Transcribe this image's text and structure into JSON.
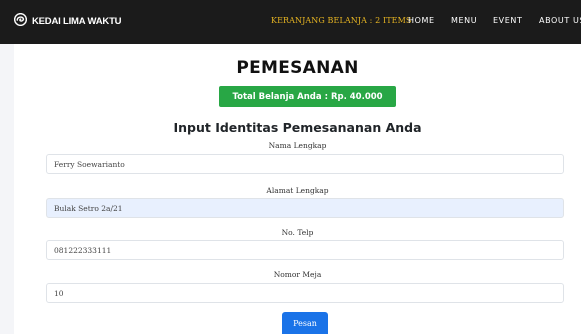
{
  "navbar": {
    "brand": "KEDAI LIMA WAKTU",
    "brand_icon": "swirl-logo-icon",
    "cart_label": "KERANJANG BELANJA : 2 ITEMS",
    "links": [
      "HOME",
      "MENU",
      "EVENT",
      "ABOUT US"
    ]
  },
  "page": {
    "title": "PEMESANAN",
    "total_label": "Total Belanja Anda : Rp. 40.000",
    "form_heading": "Input Identitas Pemesananan Anda"
  },
  "form": {
    "nama": {
      "label": "Nama Lengkap",
      "value": "Ferry Soewarianto"
    },
    "alamat": {
      "label": "Alamat Lengkap",
      "value": "Bulak Setro 2a/21"
    },
    "telp": {
      "label": "No. Telp",
      "value": "081222333111"
    },
    "meja": {
      "label": "Nomor Meja",
      "value": "10"
    },
    "submit_label": "Pesan"
  },
  "colors": {
    "navbar_bg": "#1b1b1b",
    "cart_link": "#e6b422",
    "badge_green": "#28a745",
    "button_blue": "#1a73e8",
    "autofill_bg": "#e8f0fe"
  }
}
